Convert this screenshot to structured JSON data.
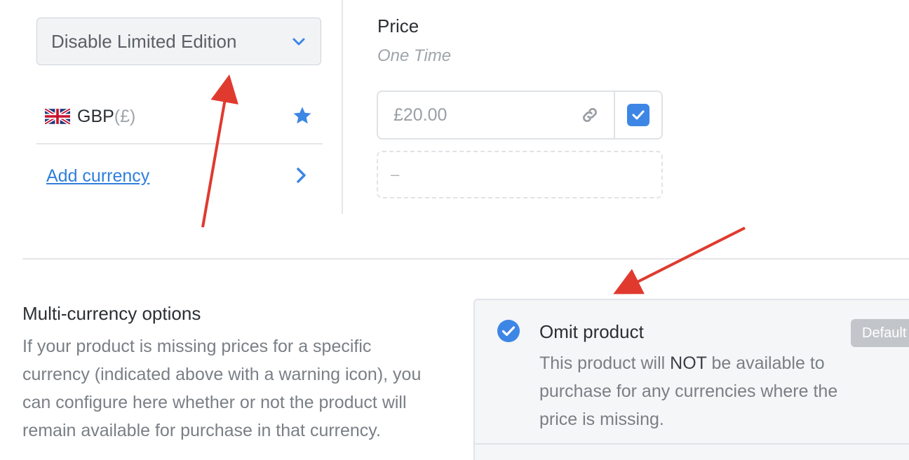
{
  "select": {
    "label": "Disable Limited Edition"
  },
  "currency": {
    "code": "GBP",
    "symbol": "(£)",
    "flag": "uk-flag-icon"
  },
  "add_currency": {
    "label": "Add currency"
  },
  "price": {
    "title": "Price",
    "subtitle": "One Time",
    "value": "£20.00",
    "empty_value": "–",
    "checked": true
  },
  "multi_currency": {
    "title": "Multi-currency options",
    "description": "If your product is missing prices for a specific currency (indicated above with a warning icon), you can configure here whether or not the product will remain available for purchase in that currency."
  },
  "option": {
    "title": "Omit product",
    "badge": "Default",
    "desc_before": "This product will ",
    "desc_emph": "NOT",
    "desc_after": " be available to purchase for any currencies where the price is missing.",
    "selected": true
  },
  "colors": {
    "accent": "#3d86e6",
    "link": "#2f7fdb",
    "annotation_arrow": "#e03a2f"
  }
}
